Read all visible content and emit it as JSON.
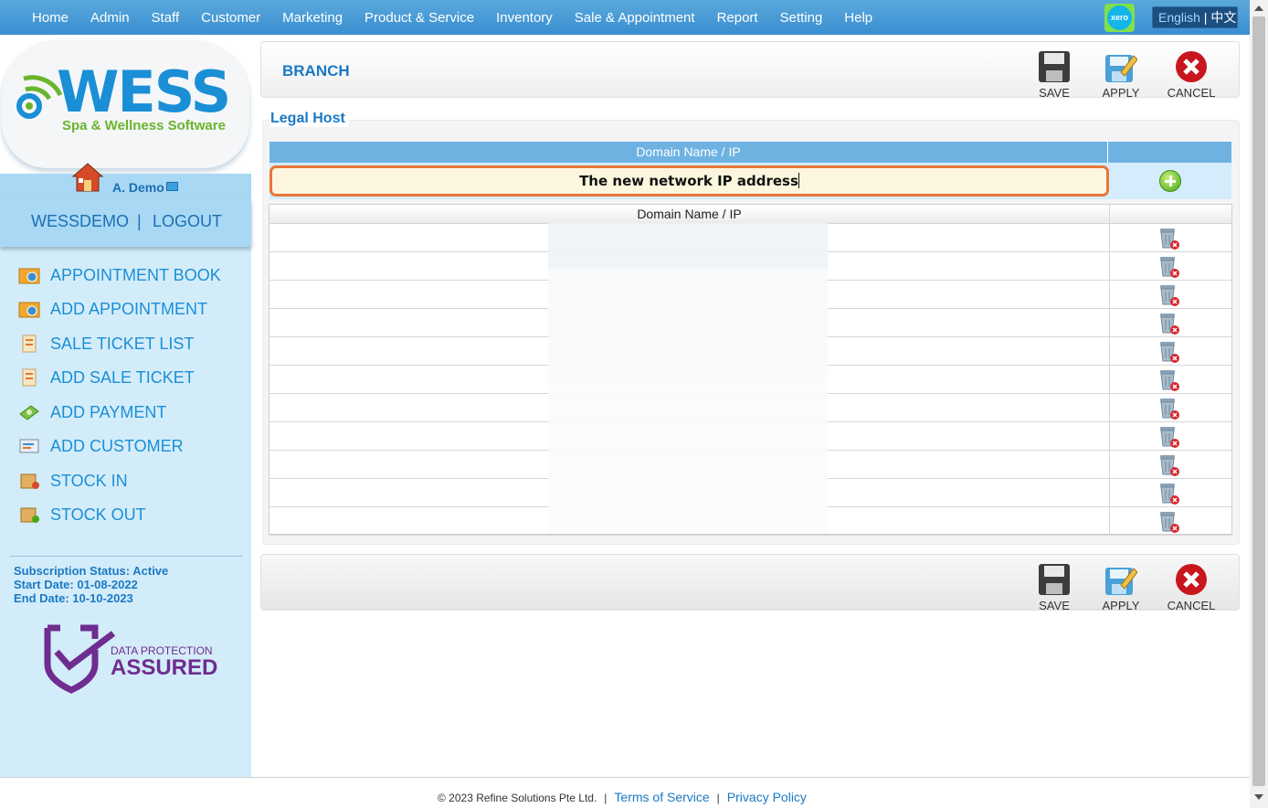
{
  "nav": {
    "items": [
      "Home",
      "Admin",
      "Staff",
      "Customer",
      "Marketing",
      "Product & Service",
      "Inventory",
      "Sale & Appointment",
      "Report",
      "Setting",
      "Help"
    ],
    "xero_label": "xero",
    "lang_en": "English",
    "lang_sep": " | ",
    "lang_zh": "中文"
  },
  "logo": {
    "brand": "WESS",
    "tagline": "Spa & Wellness Software"
  },
  "user": {
    "name": "A. Demo",
    "account": "WESSDEMO",
    "separator": "|",
    "logout": "LOGOUT"
  },
  "menu": [
    {
      "label": "APPOINTMENT BOOK",
      "icon": "appointment-book-icon"
    },
    {
      "label": "ADD APPOINTMENT",
      "icon": "add-appointment-icon"
    },
    {
      "label": "SALE TICKET LIST",
      "icon": "sale-ticket-list-icon"
    },
    {
      "label": "ADD SALE TICKET",
      "icon": "add-sale-ticket-icon"
    },
    {
      "label": "ADD PAYMENT",
      "icon": "add-payment-icon"
    },
    {
      "label": "ADD CUSTOMER",
      "icon": "add-customer-icon"
    },
    {
      "label": "STOCK IN",
      "icon": "stock-in-icon"
    },
    {
      "label": "STOCK OUT",
      "icon": "stock-out-icon"
    }
  ],
  "subscription": {
    "status": "Subscription Status: Active",
    "start": "Start Date: 01-08-2022",
    "end": "End Date: 10-10-2023"
  },
  "badge": {
    "line1": "DATA PROTECTION",
    "line2": "ASSURED"
  },
  "page": {
    "title": "BRANCH",
    "section": "Legal Host"
  },
  "toolbar": {
    "save": "SAVE",
    "apply": "APPLY",
    "cancel": "CANCEL"
  },
  "form": {
    "column_header": "Domain Name / IP",
    "input_value": "The new network IP address"
  },
  "table": {
    "column_header": "Domain Name / IP",
    "rows": [
      "",
      "",
      "",
      "",
      "",
      "",
      "",
      "",
      "",
      "",
      ""
    ]
  },
  "footer": {
    "copyright": "© 2023 Refine Solutions Pte Ltd.",
    "terms": "Terms of Service",
    "privacy": "Privacy Policy"
  },
  "colors": {
    "accent": "#1a79c4",
    "nav_bg": "#3a8ed0",
    "sidebar_bg": "#d3ecfa",
    "input_border": "#e9763a"
  }
}
